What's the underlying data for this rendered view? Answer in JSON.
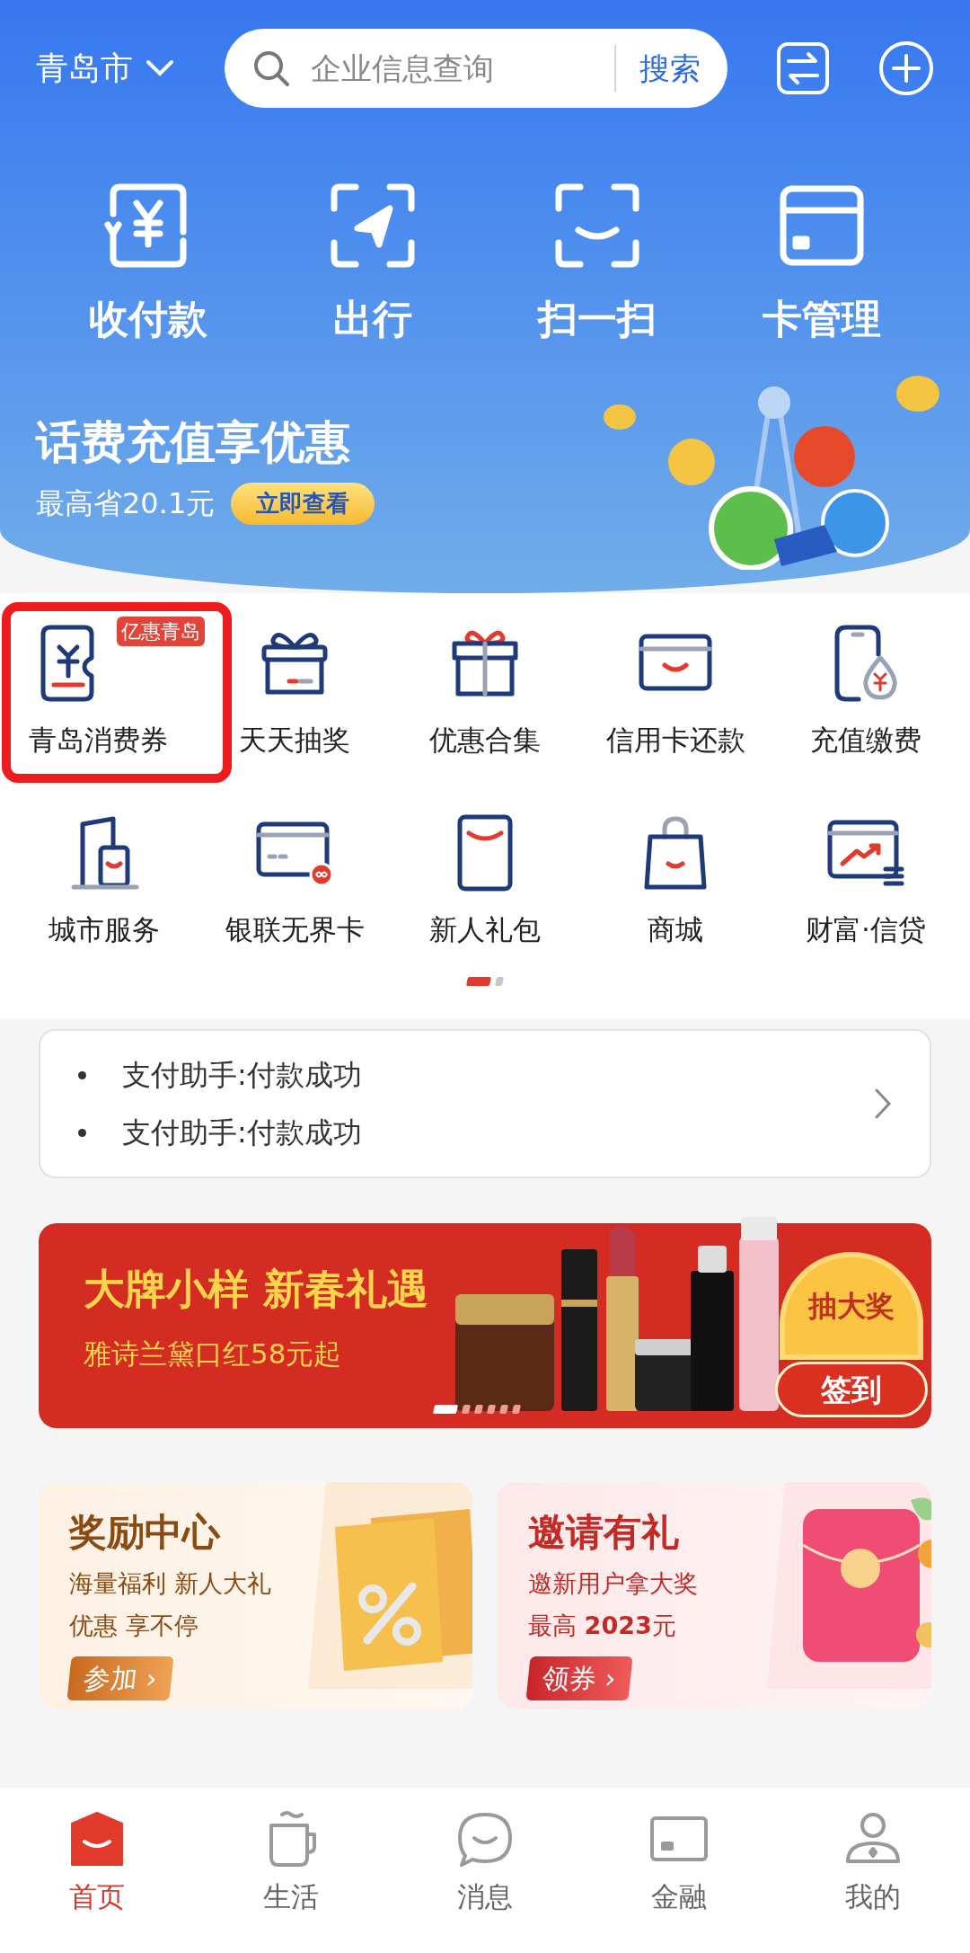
{
  "top_bar": {
    "city": "青岛市",
    "search": {
      "placeholder": "企业信息查询",
      "button": "搜索"
    }
  },
  "quick_actions": [
    {
      "label": "收付款"
    },
    {
      "label": "出行"
    },
    {
      "label": "扫一扫"
    },
    {
      "label": "卡管理"
    }
  ],
  "promo": {
    "title": "话费充值享优惠",
    "subtitle": "最高省20.1元",
    "button": "立即查看"
  },
  "services": [
    {
      "label": "青岛消费券",
      "badge": "亿惠青岛",
      "highlighted": true
    },
    {
      "label": "天天抽奖",
      "highlighted": false
    },
    {
      "label": "优惠合集",
      "highlighted": false
    },
    {
      "label": "信用卡还款",
      "highlighted": false
    },
    {
      "label": "充值缴费",
      "highlighted": false
    },
    {
      "label": "城市服务",
      "highlighted": false
    },
    {
      "label": "银联无界卡",
      "highlighted": false
    },
    {
      "label": "新人礼包",
      "highlighted": false
    },
    {
      "label": "商城",
      "highlighted": false
    },
    {
      "label": "财富·信贷",
      "highlighted": false
    }
  ],
  "service_pages": [
    {
      "selected": true
    },
    {
      "selected": false
    }
  ],
  "notices": [
    "支付助手:付款成功",
    "支付助手:付款成功"
  ],
  "banner": {
    "title": "大牌小样 新春礼遇",
    "subtitle": "雅诗兰黛口红58元起",
    "badge": "抽大奖",
    "badge_button": "签到",
    "dots": [
      {
        "selected": true
      },
      {
        "selected": false
      },
      {
        "selected": false
      },
      {
        "selected": false
      },
      {
        "selected": false
      },
      {
        "selected": false
      }
    ]
  },
  "cards": [
    {
      "title": "奖励中心",
      "lines": [
        "海量福利 新人大礼",
        "优惠 享不停"
      ],
      "button": "参加 ›",
      "color": "#8a4a12"
    },
    {
      "title": "邀请有礼",
      "lines": [
        "邀新用户拿大奖",
        "最高 **2023**元"
      ],
      "button": "领券 ›",
      "color": "#c42a25"
    }
  ],
  "tab_bar": [
    {
      "label": "首页",
      "selected": true
    },
    {
      "label": "生活",
      "selected": false
    },
    {
      "label": "消息",
      "selected": false
    },
    {
      "label": "金融",
      "selected": false
    },
    {
      "label": "我的",
      "selected": false
    }
  ]
}
